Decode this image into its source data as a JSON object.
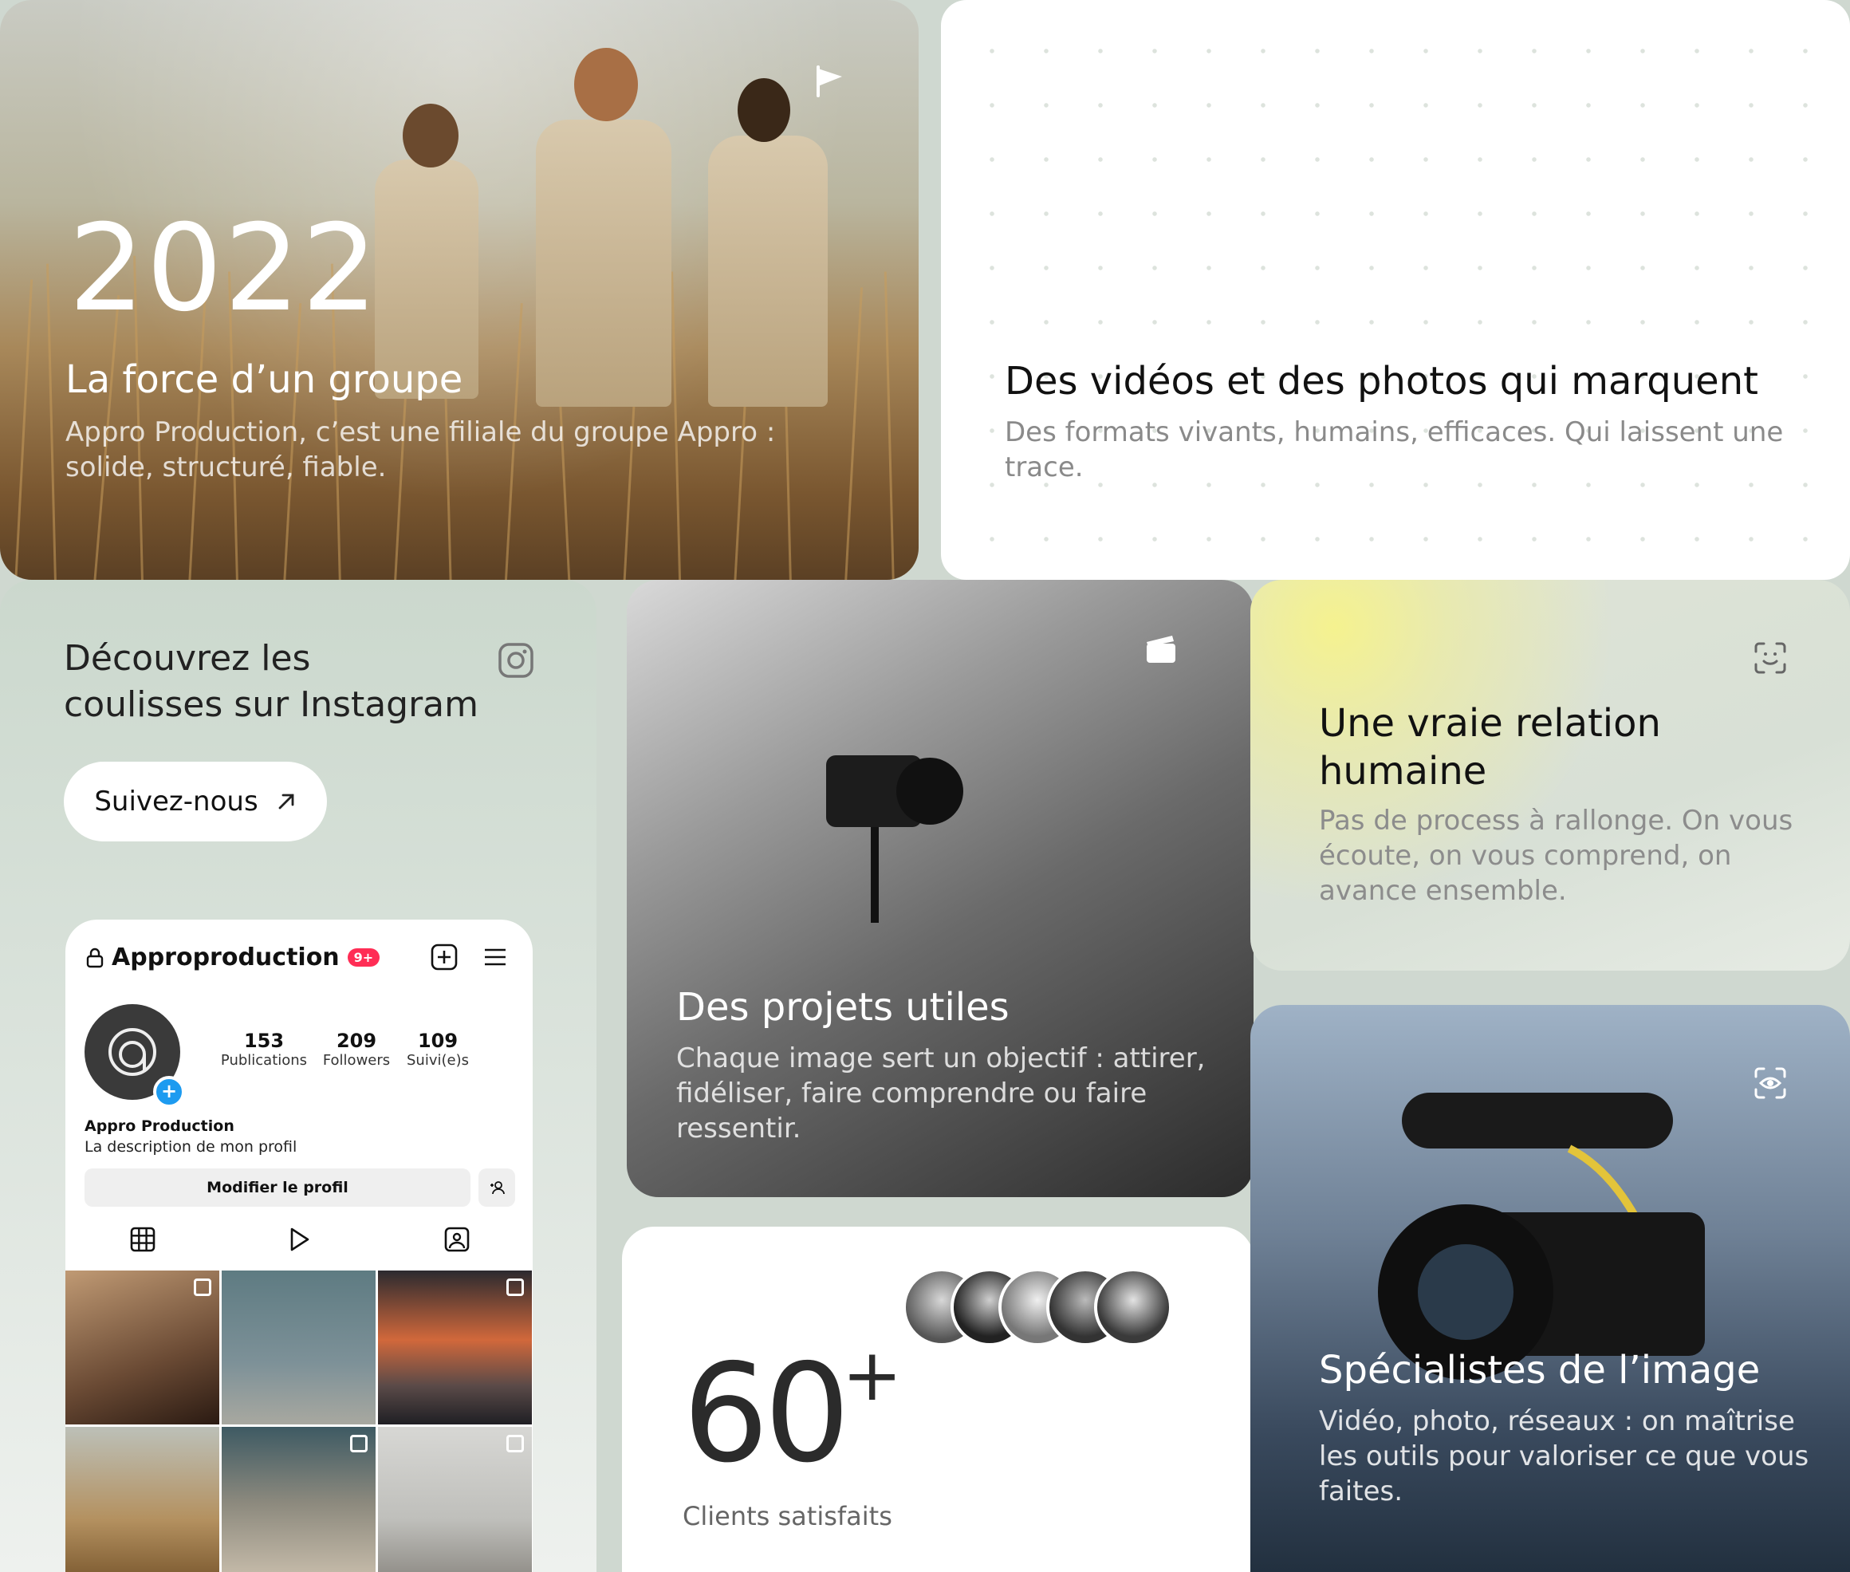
{
  "group_card": {
    "year": "2022",
    "title": "La force d’un groupe",
    "text": "Appro Production, c’est une filiale du groupe Appro : solide, structuré, fiable.",
    "icon": "flag-icon"
  },
  "videos_card": {
    "title": "Des vidéos et des photos qui marquent",
    "text": "Des formats vivants, humains, efficaces. Qui laissent une trace."
  },
  "instagram_card": {
    "title": "Découvrez les coulisses sur Instagram",
    "icon": "instagram-icon",
    "button_label": "Suivez-nous",
    "phone": {
      "username": "Approproduction",
      "badge": "9+",
      "stats": [
        {
          "value": "153",
          "label": "Publications"
        },
        {
          "value": "209",
          "label": "Followers"
        },
        {
          "value": "109",
          "label": "Suivi(e)s"
        }
      ],
      "display_name": "Appro Production",
      "description": "La description de mon profil",
      "edit_button": "Modifier le profil"
    }
  },
  "projects_card": {
    "title": "Des projets utiles",
    "text": "Chaque image sert un objectif : attirer, fidéliser, faire comprendre ou faire ressentir.",
    "icon": "clapperboard-icon"
  },
  "relation_card": {
    "title": "Une vraie relation humaine",
    "text": "Pas de process à rallonge. On vous écoute, on vous comprend, on avance ensemble.",
    "icon": "face-scan-icon"
  },
  "clients_card": {
    "number": "60",
    "plus": "+",
    "label": "Clients satisfaits"
  },
  "specialists_card": {
    "title": "Spécialistes de l’image",
    "text": "Vidéo, photo, réseaux : on maîtrise les outils pour valoriser ce que vous faites.",
    "icon": "eye-scan-icon"
  }
}
